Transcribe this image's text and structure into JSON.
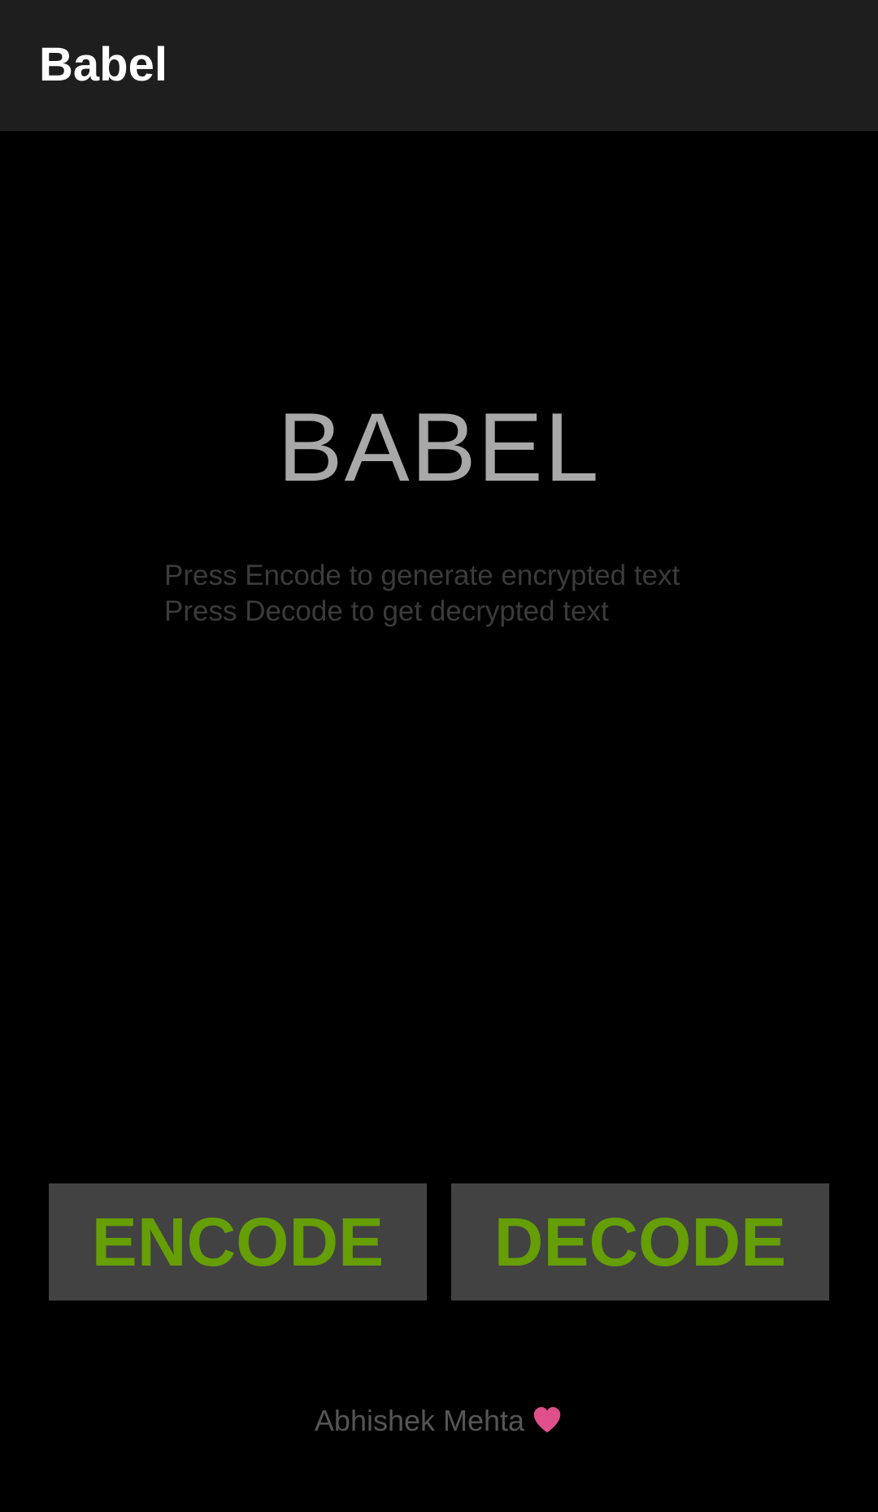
{
  "app_bar": {
    "title": "Babel"
  },
  "main": {
    "hero_title": "BABEL",
    "instructions": [
      "Press Encode to generate encrypted text",
      "Press Decode to get decrypted text"
    ]
  },
  "actions": {
    "encode_label": "ENCODE",
    "decode_label": "DECODE"
  },
  "footer": {
    "author": "Abhishek Mehta",
    "icon": "heart-icon"
  },
  "colors": {
    "background": "#000000",
    "app_bar": "#1e1e1e",
    "button_bg": "#424242",
    "button_text": "#659e05",
    "heart": "#e0508a"
  }
}
